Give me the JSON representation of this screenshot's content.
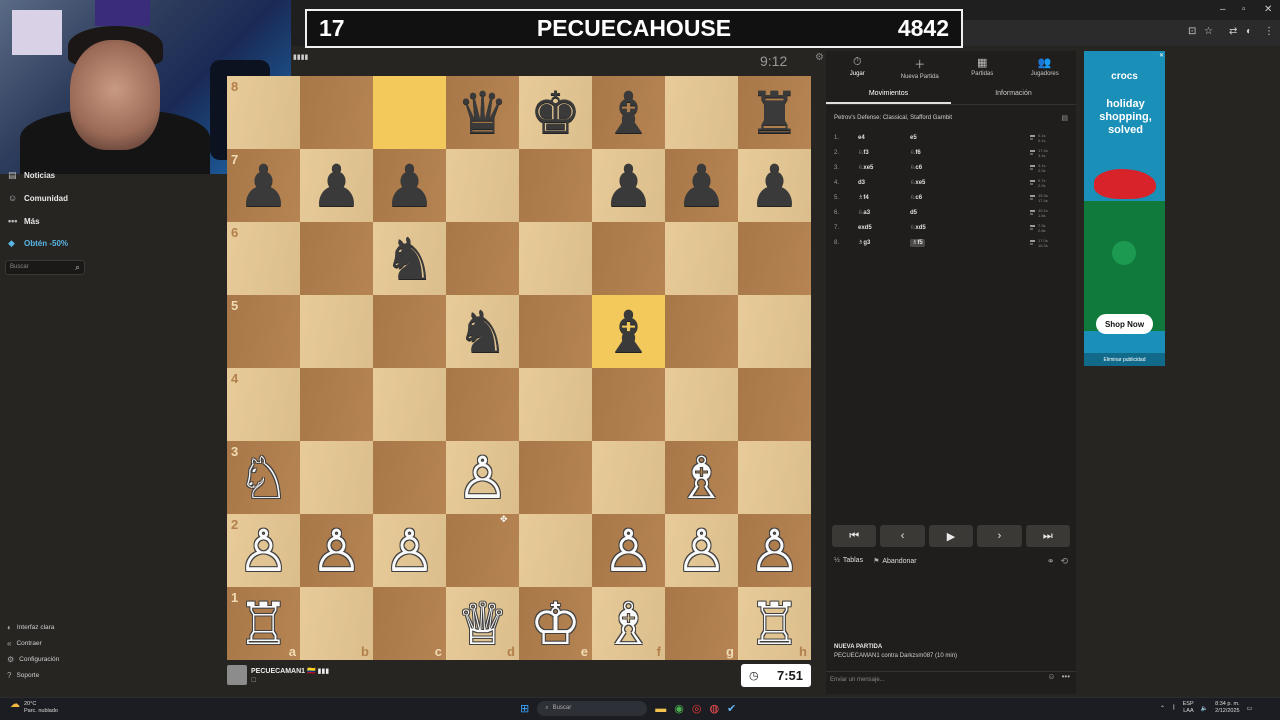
{
  "banner": {
    "left": "17",
    "title": "PECUECAHOUSE",
    "right": "4842"
  },
  "browser": {
    "window_controls": [
      "–",
      "▫",
      "✕"
    ],
    "toolbar_icons": [
      "⊡",
      "☆",
      "⇄",
      "◐",
      "⋮"
    ]
  },
  "sidebar": {
    "items": [
      {
        "label": "Noticias",
        "icon": "news-icon",
        "glyph": "▤"
      },
      {
        "label": "Comunidad",
        "icon": "community-icon",
        "glyph": "☺"
      },
      {
        "label": "Más",
        "icon": "more-icon",
        "glyph": "•••"
      },
      {
        "label": "Obtén -50%",
        "icon": "diamond-icon",
        "glyph": "◆"
      }
    ],
    "search_placeholder": "Buscar",
    "bottom": [
      {
        "label": "Interfaz clara",
        "icon": "light-mode-icon",
        "glyph": "◐"
      },
      {
        "label": "Contraer",
        "icon": "collapse-icon",
        "glyph": "«"
      },
      {
        "label": "Configuración",
        "icon": "settings-icon",
        "glyph": "⚙"
      },
      {
        "label": "Soporte",
        "icon": "help-icon",
        "glyph": "?"
      }
    ]
  },
  "opponent": {
    "clock": "9:12",
    "flag": "▮▮▮▮"
  },
  "player": {
    "name": "PECUECAMAN1 🇨🇴 ▮▮▮",
    "sub": "☐",
    "clock": "7:51",
    "clock_icon": "clock-icon"
  },
  "board": {
    "ranks": [
      "8",
      "7",
      "6",
      "5",
      "4",
      "3",
      "2",
      "1"
    ],
    "files": [
      "a",
      "b",
      "c",
      "d",
      "e",
      "f",
      "g",
      "h"
    ],
    "position": [
      [
        "",
        "",
        "",
        "♛b",
        "♚b",
        "♝b",
        "",
        "♜b"
      ],
      [
        "♟b",
        "♟b",
        "♟b",
        "",
        "",
        "♟b",
        "♟b",
        "♟b"
      ],
      [
        "",
        "",
        "♞b",
        "",
        "",
        "",
        "",
        ""
      ],
      [
        "",
        "",
        "",
        "♞b",
        "",
        "♝b",
        "",
        ""
      ],
      [
        "",
        "",
        "",
        "",
        "",
        "",
        "",
        ""
      ],
      [
        "♘w",
        "",
        "",
        "♙w",
        "",
        "",
        "♗w",
        ""
      ],
      [
        "♙w",
        "♙w",
        "♙w",
        "",
        "",
        "♙w",
        "♙w",
        "♙w"
      ],
      [
        "♖w",
        "",
        "",
        "♕w",
        "♔w",
        "♗w",
        "",
        "♖w"
      ]
    ],
    "highlights": [
      "c8",
      "f5"
    ]
  },
  "panel": {
    "tabs": [
      {
        "label": "Jugar",
        "glyph": "⏱",
        "icon": "play-clock-icon"
      },
      {
        "label": "Nueva Partida",
        "glyph": "＋",
        "icon": "new-game-icon"
      },
      {
        "label": "Partidas",
        "glyph": "▦",
        "icon": "games-grid-icon"
      },
      {
        "label": "Jugadores",
        "glyph": "👥",
        "icon": "players-icon"
      }
    ],
    "subtabs": [
      "Movimientos",
      "Información"
    ],
    "opening": "Petrov's Defense: Classical, Stafford Gambit",
    "moves": [
      {
        "num": "1.",
        "white": "e4",
        "black": "e5",
        "t1": "0.1s",
        "t2": "0.1s"
      },
      {
        "num": "2.",
        "white": "♘f3",
        "black": "♘f6",
        "t1": "17.4s",
        "t2": "3.4s"
      },
      {
        "num": "3.",
        "white": "♘xe5",
        "black": "♘c6",
        "t1": "3.1s",
        "t2": "2.0s"
      },
      {
        "num": "4.",
        "white": "d3",
        "black": "♘xe5",
        "t1": "9.7s",
        "t2": "2.0s"
      },
      {
        "num": "5.",
        "white": "♗f4",
        "black": "♘c6",
        "t1": "15.3s",
        "t2": "17.4s"
      },
      {
        "num": "6.",
        "white": "♘a3",
        "black": "d5",
        "t1": "40.1s",
        "t2": "1.8s"
      },
      {
        "num": "7.",
        "white": "exd5",
        "black": "♘xd5",
        "t1": "7.3s",
        "t2": "2.8s"
      },
      {
        "num": "8.",
        "white": "♗g3",
        "black": "♗f5",
        "t1": "17.0s",
        "t2": "16.3s"
      }
    ],
    "nav": [
      "⏮",
      "‹",
      "▶",
      "›",
      "⏭"
    ],
    "actions": [
      {
        "label": "Tablas",
        "glyph": "½",
        "icon": "draw-icon"
      },
      {
        "label": "Abandonar",
        "glyph": "⚑",
        "icon": "resign-flag-icon"
      }
    ],
    "game_info": {
      "heading": "NUEVA PARTIDA",
      "line": "PECUECAMAN1 contra Darkzsm087 (10 min)"
    },
    "chat_placeholder": "Enviar un mensaje..."
  },
  "ad": {
    "brand": "crocs",
    "headline": "holiday shopping, solved",
    "button": "Shop Now",
    "remove": "Eliminar publicidad"
  },
  "taskbar": {
    "weather_temp": "20°C",
    "weather_desc": "Parc. nublado",
    "search": "Buscar",
    "lang": "ESP",
    "lang2": "LAA",
    "time": "8:34 p. m.",
    "date": "2/12/2025"
  }
}
